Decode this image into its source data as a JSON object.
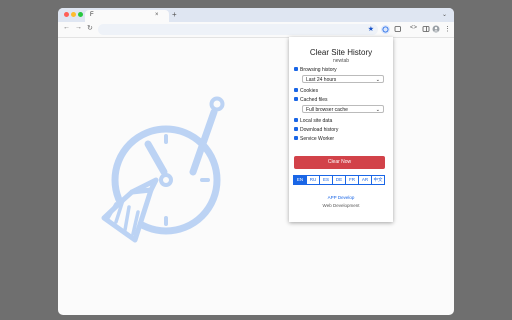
{
  "browser": {
    "tab_favicon": "F",
    "tab_close": "×",
    "new_tab": "+",
    "tab_list": "⌄",
    "back": "←",
    "forward": "→",
    "reload": "↻",
    "bookmark_icon": "★",
    "menu": "⋮"
  },
  "popup": {
    "title": "Clear Site History",
    "subtitle": "newtab",
    "options": {
      "browsing_history": "Browsing history",
      "time_range": "Last 24 hours",
      "cookies": "Cookies",
      "cached_files": "Cached files",
      "cache_scope": "Full browser cache",
      "local_site_data": "Local site data",
      "download_history": "Download history",
      "service_worker": "Service Worker"
    },
    "clear_button": "Clear Now",
    "languages": [
      "EN",
      "RU",
      "ES",
      "DE",
      "FR",
      "AR",
      "中文"
    ],
    "active_language": "EN",
    "footer_link": "APP Develop",
    "footer_text": "Web Development"
  },
  "colors": {
    "accent": "#1a66e6",
    "danger": "#d24249",
    "illustration": "#bcd3f4"
  }
}
